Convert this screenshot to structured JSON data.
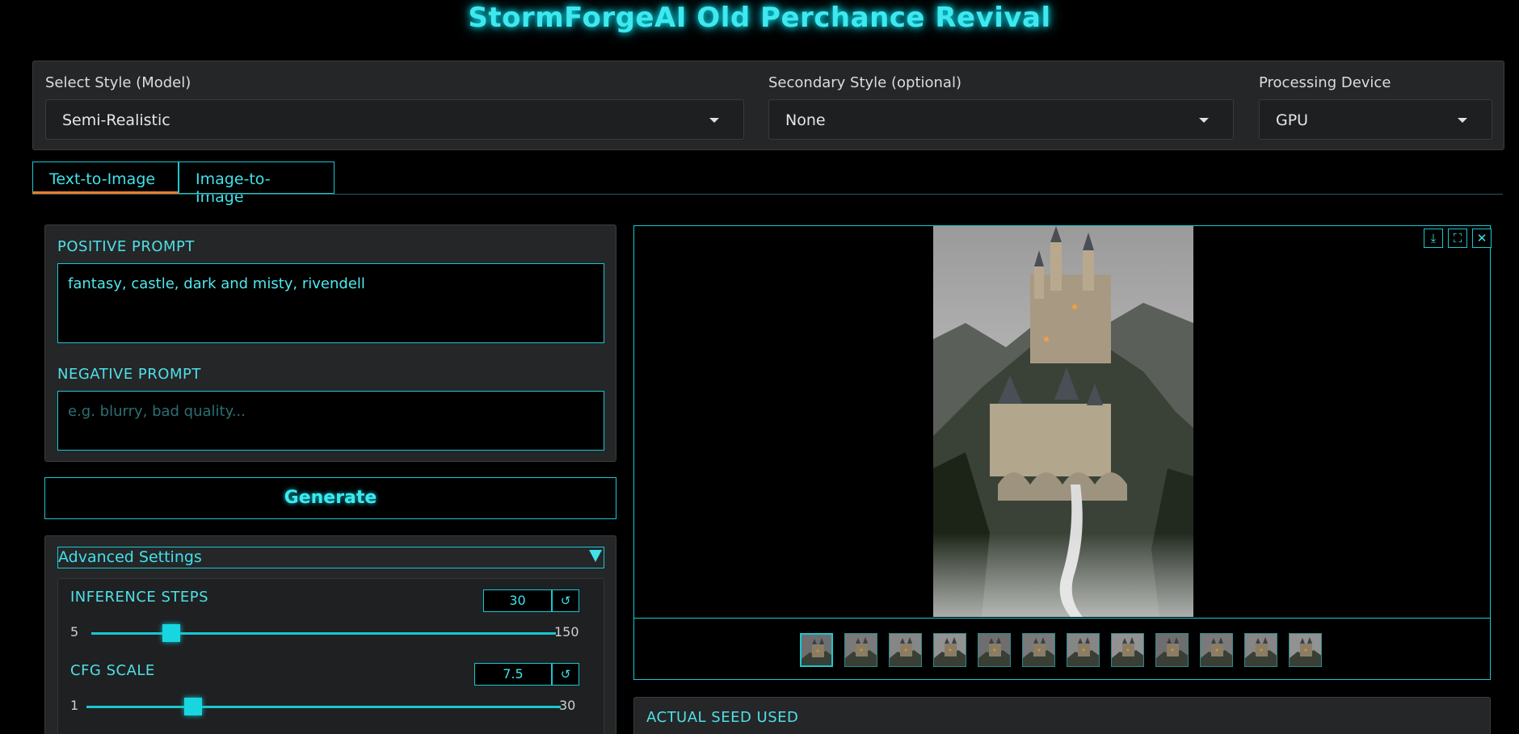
{
  "app": {
    "title": "StormForgeAI Old Perchance Revival"
  },
  "selectors": {
    "style": {
      "label": "Select Style (Model)",
      "value": "Semi-Realistic"
    },
    "secondary": {
      "label": "Secondary Style (optional)",
      "value": "None"
    },
    "device": {
      "label": "Processing Device",
      "value": "GPU"
    }
  },
  "tabs": [
    {
      "label": "Text-to-Image",
      "active": true
    },
    {
      "label": "Image-to-Image",
      "active": false
    }
  ],
  "prompts": {
    "positive_label": "POSITIVE PROMPT",
    "positive_value": "fantasy, castle, dark and misty, rivendell",
    "negative_label": "NEGATIVE PROMPT",
    "negative_placeholder": "e.g. blurry, bad quality..."
  },
  "generate": {
    "label": "Generate"
  },
  "advanced": {
    "header": "Advanced Settings",
    "steps": {
      "label": "INFERENCE STEPS",
      "value": "30",
      "min": "5",
      "max": "150",
      "current": 30,
      "reset_icon": "↺"
    },
    "cfg": {
      "label": "CFG SCALE",
      "value": "7.5",
      "min": "1",
      "max": "30",
      "current": 7.5,
      "reset_icon": "↺"
    }
  },
  "gallery": {
    "controls": [
      {
        "icon": "download-icon",
        "glyph": "⤓"
      },
      {
        "icon": "fullscreen-icon",
        "glyph": "⛶"
      },
      {
        "icon": "close-icon",
        "glyph": "✕"
      }
    ],
    "thumbnail_count": 12,
    "selected_index": 0
  },
  "seed": {
    "label": "ACTUAL SEED USED"
  },
  "colors": {
    "accent": "#18c8d2",
    "tab_active": "#f07a28",
    "panel": "#252628"
  }
}
